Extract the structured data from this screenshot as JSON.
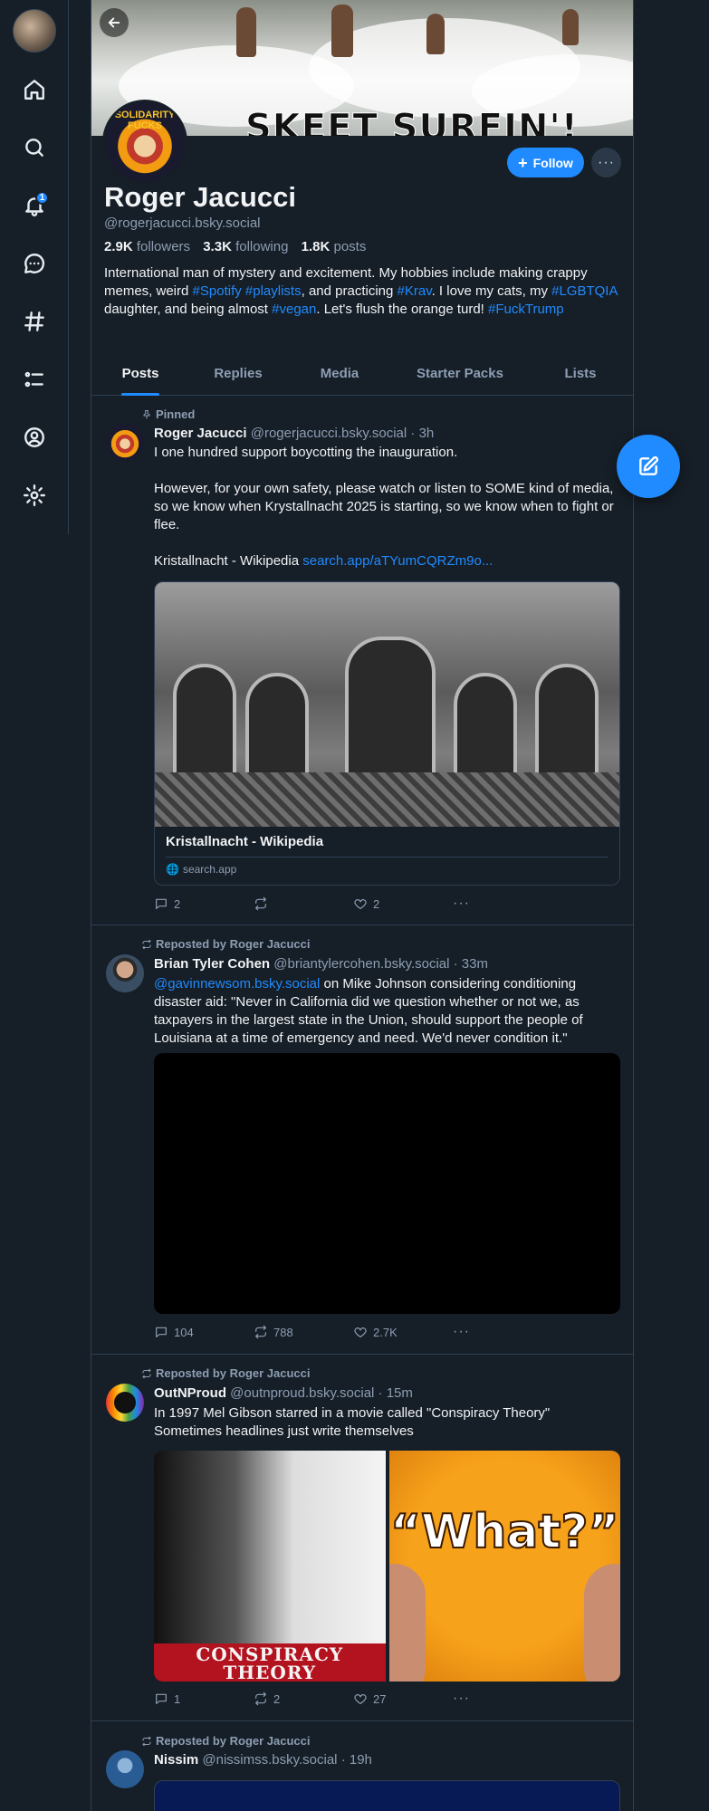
{
  "nav": {
    "notifications_badge": "1",
    "items": [
      "home-icon",
      "search-icon",
      "bell-icon",
      "chat-icon",
      "hash-icon",
      "list-icon",
      "profile-icon",
      "gear-icon"
    ]
  },
  "profile": {
    "banner_text": "SKEET SURFIN'!",
    "avatar_text": "SOLIDARITY FUCKS",
    "name": "Roger Jacucci",
    "handle": "@rogerjacucci.bsky.social",
    "followers_count": "2.9K",
    "followers_label": "followers",
    "following_count": "3.3K",
    "following_label": "following",
    "posts_count": "1.8K",
    "posts_label": "posts",
    "follow_label": "Follow",
    "more_label": "···",
    "bio": {
      "t1": "International man of mystery and excitement. My hobbies include making crappy memes, weird ",
      "h1": "#Spotify",
      "t2": " ",
      "h2": "#playlists",
      "t3": ", and practicing ",
      "h3": "#Krav",
      "t4": ". I love my cats, my ",
      "h4": "#LGBTQIA",
      "t5": " daughter, and being almost ",
      "h5": "#vegan",
      "t6": ". Let's flush the orange turd! ",
      "h6": "#FuckTrump"
    }
  },
  "tabs": [
    "Posts",
    "Replies",
    "Media",
    "Starter Packs",
    "Lists"
  ],
  "posts": [
    {
      "context": "Pinned",
      "author": "Roger Jacucci",
      "handle": "@rogerjacucci.bsky.social",
      "time": "· 3h",
      "text_p1": "I one hundred support boycotting the inauguration.",
      "text_p2": "However, for your own safety, please watch or listen to SOME kind of media, so we know when Krystallnacht 2025 is starting, so we know when to fight or flee.",
      "text_p3": "Kristallnacht - Wikipedia ",
      "link": "search.app/aTYumCQRZm9o...",
      "embed_title": "Kristallnacht - Wikipedia",
      "embed_host": "search.app",
      "replies": "2",
      "reposts": "",
      "likes": "2"
    },
    {
      "context": "Reposted by Roger Jacucci",
      "author": "Brian Tyler Cohen",
      "handle": "@briantylercohen.bsky.social",
      "time": "· 33m",
      "mention": "@gavinnewsom.bsky.social",
      "text": " on Mike Johnson considering conditioning disaster aid: \"Never in California did we question whether or not we, as taxpayers in the largest state in the Union, should support the people of Louisiana at a time of emergency and need. We'd never condition it.\"",
      "replies": "104",
      "reposts": "788",
      "likes": "2.7K"
    },
    {
      "context": "Reposted by Roger Jacucci",
      "author": "OutNProud",
      "handle": "@outnproud.bsky.social",
      "time": "· 15m",
      "text_l1": "In 1997 Mel Gibson starred in a movie called \"Conspiracy Theory\"",
      "text_l2": "Sometimes headlines just write themselves",
      "poster_text": "CONSPIRACY THEORY",
      "image2_text": "“What?”",
      "replies": "1",
      "reposts": "2",
      "likes": "27"
    },
    {
      "context": "Reposted by Roger Jacucci",
      "author": "Nissim",
      "handle": "@nissimss.bsky.social",
      "time": "· 19h"
    }
  ],
  "colors": {
    "accent": "#208bfe",
    "background": "#161e27",
    "border": "#2e4052",
    "muted": "#8d9eb3"
  }
}
